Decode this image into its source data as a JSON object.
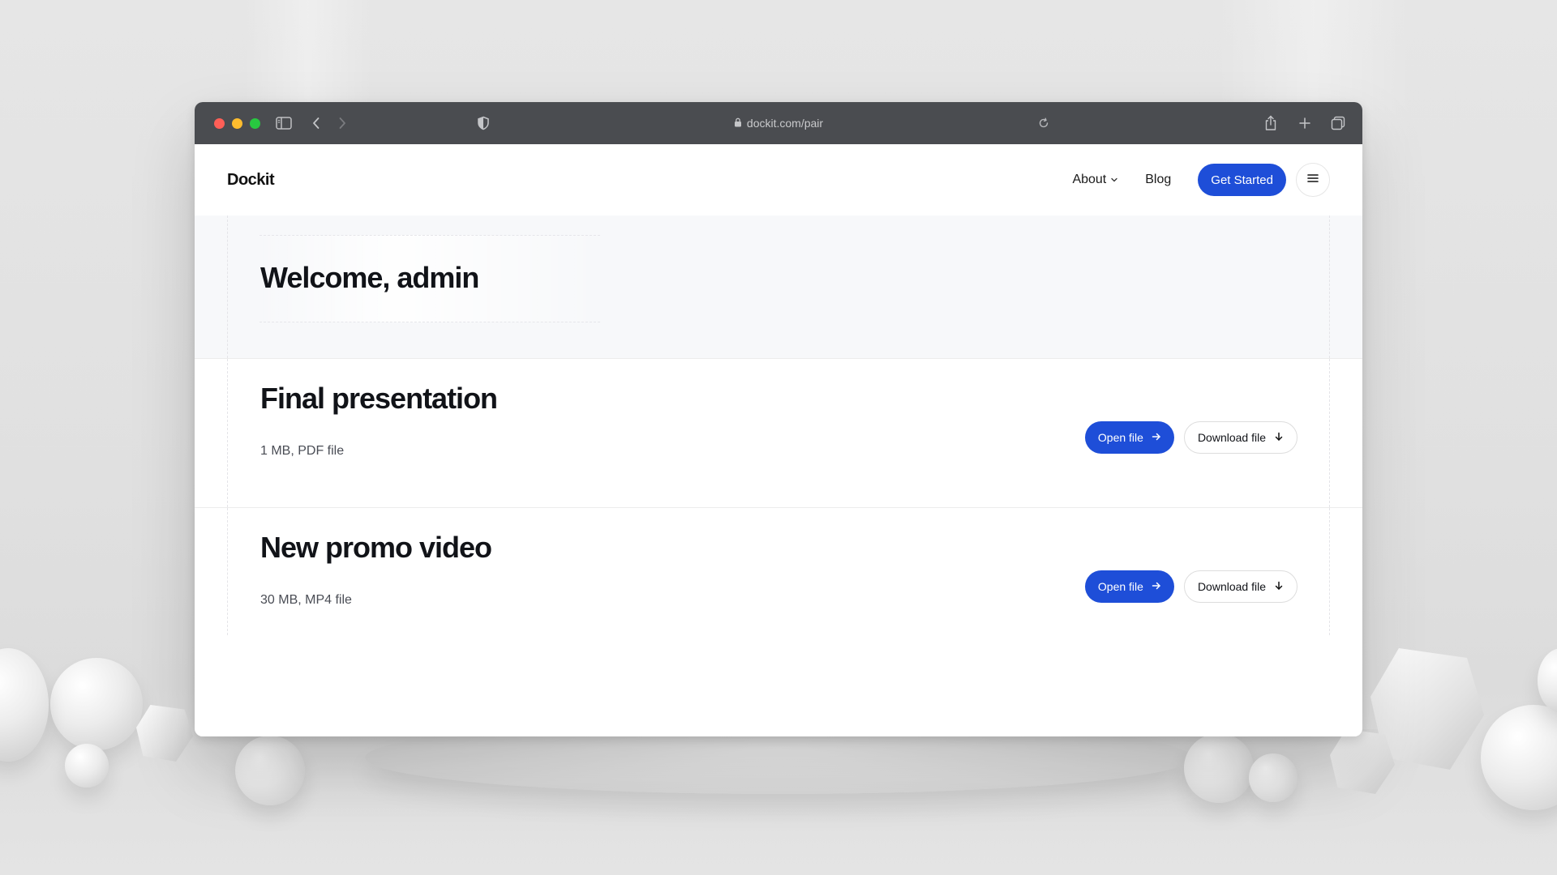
{
  "browser": {
    "url": "dockit.com/pair",
    "icons": {
      "sidebar": "sidebar-icon",
      "back": "chevron-left-icon",
      "forward": "chevron-right-icon",
      "shield": "shield-icon",
      "lock": "lock-icon",
      "reload": "reload-icon",
      "share": "share-icon",
      "new_tab": "plus-icon",
      "tabs": "tabs-overview-icon"
    }
  },
  "nav": {
    "logo": "Dockit",
    "about_label": "About",
    "blog_label": "Blog",
    "cta_label": "Get Started",
    "menu_icon": "hamburger-icon"
  },
  "welcome": {
    "title": "Welcome, admin"
  },
  "files": [
    {
      "title": "Final presentation",
      "meta": "1 MB, PDF file",
      "open_label": "Open file",
      "download_label": "Download file"
    },
    {
      "title": "New promo video",
      "meta": "30 MB, MP4 file",
      "open_label": "Open file",
      "download_label": "Download file"
    }
  ],
  "colors": {
    "accent": "#1e4ed8",
    "titlebar": "#4a4c50",
    "traffic_red": "#ff5f57",
    "traffic_yellow": "#febc2e",
    "traffic_green": "#28c840"
  }
}
